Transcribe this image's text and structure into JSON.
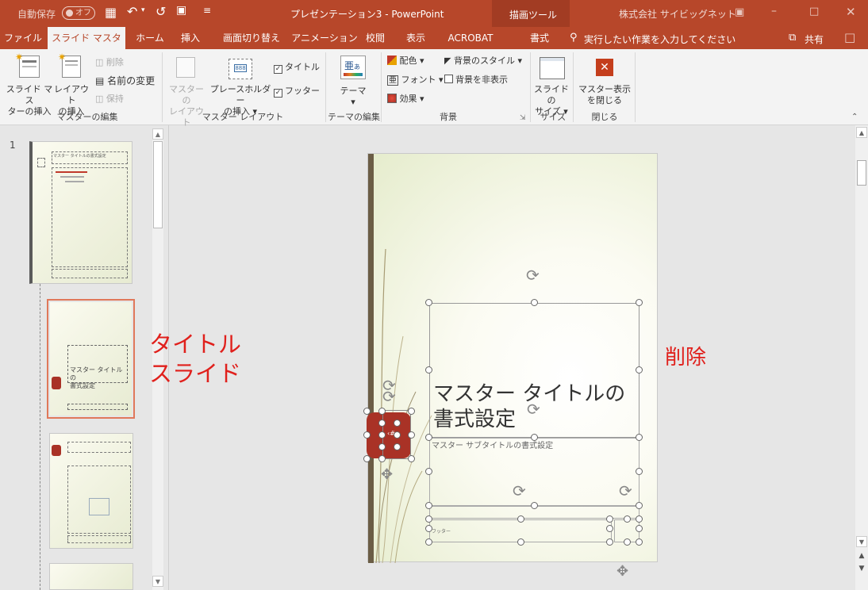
{
  "titlebar": {
    "autosave": "自動保存",
    "autosave_state": "オフ",
    "doc_title": "プレゼンテーション3 - PowerPoint",
    "context_tab": "描画ツール",
    "account": "株式会社 サイビッグネット"
  },
  "tabs": [
    "ファイル",
    "スライド マスター",
    "ホーム",
    "挿入",
    "画面切り替え",
    "アニメーション",
    "校閲",
    "表示",
    "ACROBAT",
    "書式"
  ],
  "tellme": "実行したい作業を入力してください",
  "share": "共有",
  "ribbon": {
    "insert_master": [
      "スライド マス",
      "ターの挿入"
    ],
    "insert_layout": [
      "レイアウト",
      "の挿入"
    ],
    "delete": "削除",
    "rename": "名前の変更",
    "preserve": "保持",
    "master_layout": [
      "マスターの",
      "レイアウト"
    ],
    "insert_placeholder": [
      "プレースホルダー",
      "の挿入"
    ],
    "title_chk": "タイトル",
    "footer_chk": "フッター",
    "theme": "テーマ",
    "colors": "配色",
    "fonts": "フォント",
    "effects": "効果",
    "bg_styles": "背景のスタイル",
    "hide_bg": "背景を非表示",
    "slide_size": [
      "スライドの",
      "サイズ"
    ],
    "close_master": [
      "マスター表示",
      "を閉じる"
    ],
    "groups": [
      "マスターの編集",
      "マスター レイアウト",
      "テーマの編集",
      "背景",
      "サイズ",
      "閉じる"
    ]
  },
  "thumbs": {
    "num1": "1",
    "master_title": "マスター タイトルの書式設定",
    "layout_title": [
      "マスター タイトルの",
      "書式設定"
    ]
  },
  "annotations": {
    "title_slide": [
      "タイトル",
      "スライド"
    ],
    "delete": "削除"
  },
  "slide": {
    "title": [
      "マスター タイトルの",
      "書式設定"
    ],
    "subtitle": "マスター サブタイトルの書式設定",
    "footer": "フッター",
    "num": "‹#›"
  }
}
